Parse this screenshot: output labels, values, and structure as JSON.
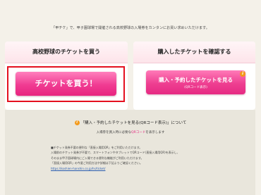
{
  "intro": "「甲チケ」で、甲子園球場で開催される高校野球の入場券をカンタンにお買い求めいただけます。",
  "left_panel": {
    "title": "高校野球のチケットを買う",
    "buy_button": "チケットを買う！"
  },
  "right_panel": {
    "title": "購入したチケットを確認する",
    "view_button": "購入・予約したチケットを見る",
    "view_button_sub": "(QRコード表示)",
    "info_icon": "i"
  },
  "notice": {
    "icon": "i",
    "title": "「購入・予約したチケットを見る(QRコード表示)」について",
    "subtitle_prefix": "入場券を買入時に必要な",
    "subtitle_highlight": "QRコード",
    "subtitle_suffix": "を表示します",
    "lines": [
      "■チケット発券不要の便利な「直接入場用QR」をご利用いただけます。",
      "入場前のチケット発券が不要で、スマートフォンやタブレットでQRコード(直接入場用QR)を表示し、",
      "そのまま甲子園球場内にご入場できる便利な機能がご利用いただけます。",
      "「直接入場用QR」の今夏ご利用方法や詳細は下記よりご確認ください。"
    ],
    "link": "https://koshien-hanshin.co.jp/hs/ticket/"
  },
  "colors": {
    "accent_pink": "#ee3f91",
    "highlight_red": "#e4101f",
    "info_orange": "#f39a1b",
    "background": "#f4f1e9"
  }
}
